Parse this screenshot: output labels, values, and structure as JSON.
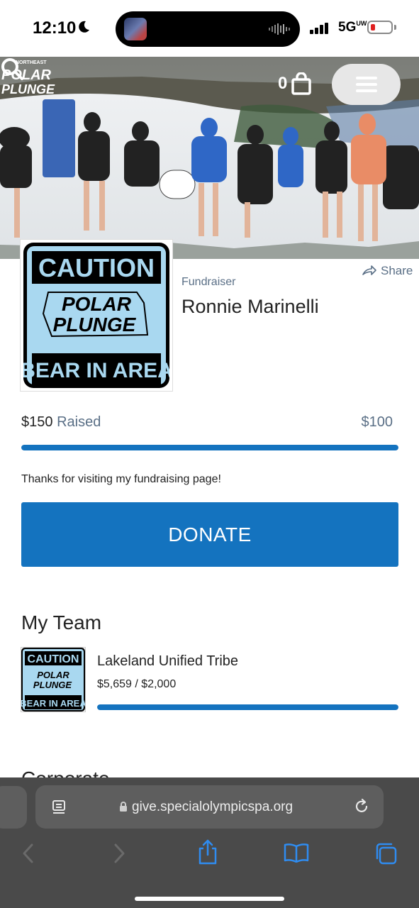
{
  "status_bar": {
    "time": "12:10",
    "network": "5G",
    "network_sup": "UW"
  },
  "header": {
    "event_logo": "Northeast Polar Plunge",
    "cart_count": "0"
  },
  "fundraiser": {
    "role": "Fundraiser",
    "name": "Ronnie Marinelli",
    "share_label": "Share",
    "avatar_text": {
      "top": "CAUTION",
      "line1": "POLAR",
      "line2": "PLUNGE",
      "bottom": "BEAR IN AREA"
    }
  },
  "progress": {
    "raised_amount": "$150",
    "raised_label": "Raised",
    "goal": "$100",
    "fraction": 1.0
  },
  "thanks_message": "Thanks for visiting my fundraising page!",
  "donate_label": "DONATE",
  "team": {
    "heading": "My Team",
    "name": "Lakeland Unified Tribe",
    "amounts": "$5,659 / $2,000",
    "fraction": 1.0
  },
  "next_section_heading": "Corporate",
  "browser": {
    "url": "give.specialolympicspa.org"
  },
  "colors": {
    "primary": "#1473bf",
    "muted_text": "#5a6f86",
    "sign_bg": "#a9d8f0"
  },
  "icons": [
    "moon-icon",
    "signal-icon",
    "battery-icon",
    "search-icon",
    "cart-icon",
    "menu-icon",
    "share-icon",
    "lock-icon",
    "reload-icon",
    "back-icon",
    "forward-icon",
    "share-sheet-icon",
    "bookmarks-icon",
    "tabs-icon",
    "reader-icon"
  ]
}
